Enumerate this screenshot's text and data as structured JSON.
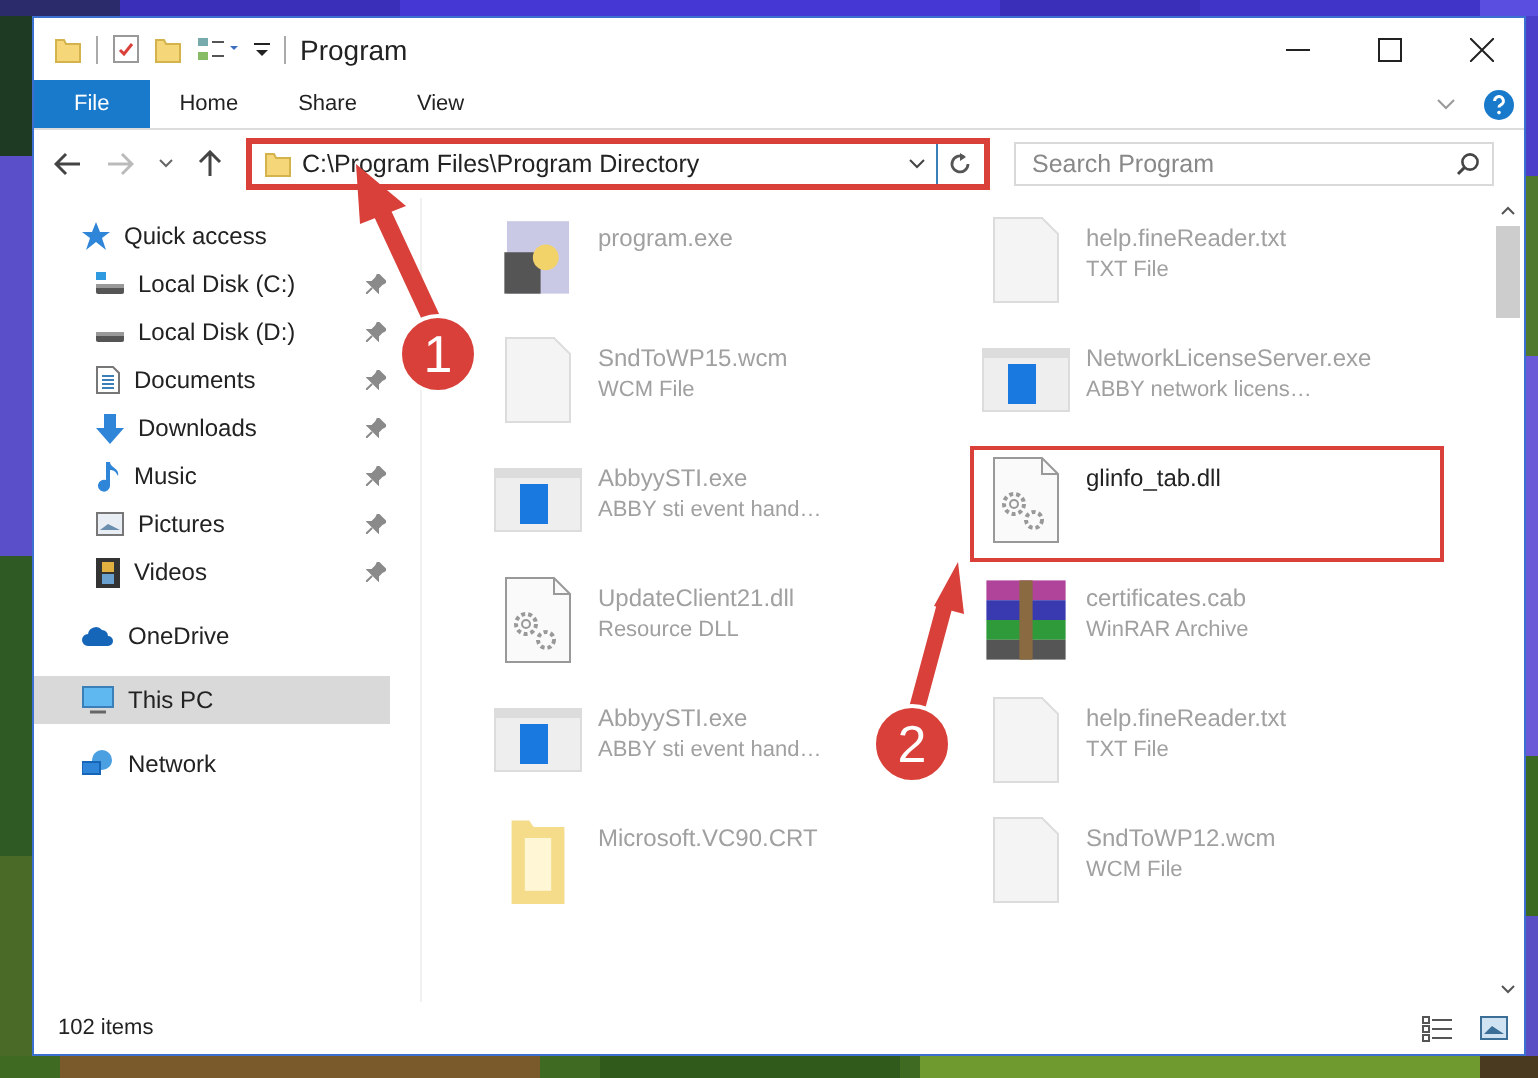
{
  "window": {
    "title": "Program"
  },
  "ribbon_tabs": [
    {
      "label": "File",
      "selected": true
    },
    {
      "label": "Home",
      "selected": false
    },
    {
      "label": "Share",
      "selected": false
    },
    {
      "label": "View",
      "selected": false
    }
  ],
  "address": {
    "path": "C:\\Program Files\\Program Directory",
    "highlighted": true
  },
  "search": {
    "placeholder": "Search Program"
  },
  "sidebar": {
    "items": [
      {
        "label": "Quick access",
        "selected": false,
        "children": [
          {
            "label": "Local Disk (C:)",
            "pinned": true,
            "selected": false
          },
          {
            "label": "Local Disk (D:)",
            "pinned": true,
            "selected": false
          },
          {
            "label": "Documents",
            "pinned": true,
            "selected": false
          },
          {
            "label": "Downloads",
            "pinned": true,
            "selected": false
          },
          {
            "label": "Music",
            "pinned": true,
            "selected": false
          },
          {
            "label": "Pictures",
            "pinned": true,
            "selected": false
          },
          {
            "label": "Videos",
            "pinned": true,
            "selected": false
          }
        ]
      },
      {
        "label": "OneDrive",
        "selected": false
      },
      {
        "label": "This PC",
        "selected": true
      },
      {
        "label": "Network",
        "selected": false
      }
    ]
  },
  "files": [
    {
      "name": "program.exe",
      "blurred": true,
      "highlighted": false
    },
    {
      "name": "help.fineReader.txt",
      "type": "TXT File",
      "blurred": true,
      "highlighted": false
    },
    {
      "name": "SndToWP15.wcm",
      "type": "WCM File",
      "blurred": true,
      "highlighted": false
    },
    {
      "name": "NetworkLicenseServer.exe",
      "type": "ABBY network licens…",
      "blurred": true,
      "highlighted": false
    },
    {
      "name": "AbbyySTI.exe",
      "type": "ABBY sti event hand…",
      "blurred": true,
      "highlighted": false
    },
    {
      "name": "glinfo_tab.dll",
      "blurred": false,
      "highlighted": true
    },
    {
      "name": "UpdateClient21.dll",
      "type": "Resource DLL",
      "blurred": true,
      "highlighted": false
    },
    {
      "name": "certificates.cab",
      "type": "WinRAR Archive",
      "blurred": true,
      "highlighted": false
    },
    {
      "name": "AbbyySTI.exe",
      "type": "ABBY sti event hand…",
      "blurred": true,
      "highlighted": false
    },
    {
      "name": "help.fineReader.txt",
      "type": "TXT File",
      "blurred": true,
      "highlighted": false
    },
    {
      "name": "Microsoft.VC90.CRT",
      "blurred": true,
      "highlighted": false
    },
    {
      "name": "SndToWP12.wcm",
      "type": "WCM File",
      "blurred": true,
      "highlighted": false
    }
  ],
  "status_bar": {
    "item_count": "102 items"
  },
  "annotations": [
    {
      "number": "1"
    },
    {
      "number": "2"
    }
  ]
}
